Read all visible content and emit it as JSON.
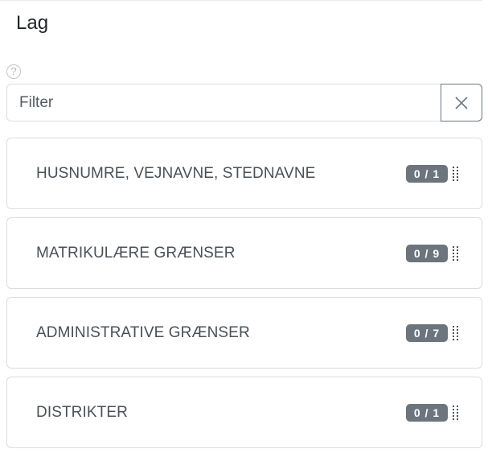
{
  "panel": {
    "title": "Lag",
    "help_symbol": "?"
  },
  "filter": {
    "placeholder": "Filter",
    "value": "",
    "clear_icon": "close-icon"
  },
  "layers": [
    {
      "label": "HUSNUMRE, VEJNAVNE, STEDNAVNE",
      "badge": "0 / 1"
    },
    {
      "label": "MATRIKULÆRE GRÆNSER",
      "badge": "0 / 9"
    },
    {
      "label": "ADMINISTRATIVE GRÆNSER",
      "badge": "0 / 7"
    },
    {
      "label": "DISTRIKTER",
      "badge": "0 / 1"
    }
  ],
  "colors": {
    "badge_background": "#6c757d",
    "text": "#495057",
    "border": "#dcdcdc"
  }
}
